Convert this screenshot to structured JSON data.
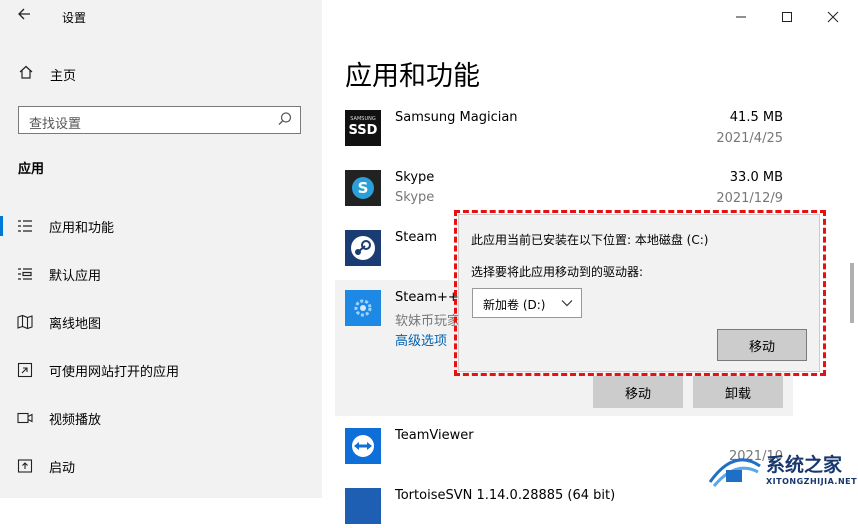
{
  "window": {
    "title": "设置",
    "controls": {
      "minimize": "—",
      "maximize": "☐",
      "close": "✕"
    }
  },
  "sidebar": {
    "home_label": "主页",
    "search_placeholder": "查找设置",
    "section_title": "应用",
    "items": [
      {
        "label": "应用和功能",
        "icon": "apps-features-icon",
        "active": true
      },
      {
        "label": "默认应用",
        "icon": "default-apps-icon",
        "active": false
      },
      {
        "label": "离线地图",
        "icon": "offline-maps-icon",
        "active": false
      },
      {
        "label": "可使用网站打开的应用",
        "icon": "apps-for-websites-icon",
        "active": false
      },
      {
        "label": "视频播放",
        "icon": "video-playback-icon",
        "active": false
      },
      {
        "label": "启动",
        "icon": "startup-icon",
        "active": false
      }
    ]
  },
  "main": {
    "heading": "应用和功能",
    "apps": [
      {
        "name": "Samsung Magician",
        "publisher": "",
        "size": "41.5 MB",
        "date": "2021/4/25"
      },
      {
        "name": "Skype",
        "publisher": "Skype",
        "size": "33.0 MB",
        "date": "2021/12/9"
      },
      {
        "name": "Steam",
        "publisher": "",
        "size": "",
        "date": ""
      },
      {
        "name": "Steam++",
        "publisher": "软妹币玩家",
        "size": "",
        "date": "",
        "advanced": "高级选项",
        "move_label": "移动",
        "uninstall_label": "卸载"
      },
      {
        "name": "TeamViewer",
        "publisher": "",
        "size": "",
        "date": "2021/10"
      },
      {
        "name": "TortoiseSVN 1.14.0.28885 (64 bit)",
        "publisher": "",
        "size": "",
        "date": ""
      }
    ],
    "ssd_badge": {
      "brand": "SAMSUNG",
      "text": "SSD"
    }
  },
  "move_dialog": {
    "location_text": "此应用当前已安装在以下位置: 本地磁盘 (C:)",
    "select_text": "选择要将此应用移动到的驱动器:",
    "selected_drive": "新加卷 (D:)",
    "move_button": "移动"
  },
  "watermark": {
    "title": "系统之家",
    "subtitle": "XITONGZHIJIA.NET"
  },
  "colors": {
    "accent": "#0078d7",
    "highlight": "#e81010"
  }
}
